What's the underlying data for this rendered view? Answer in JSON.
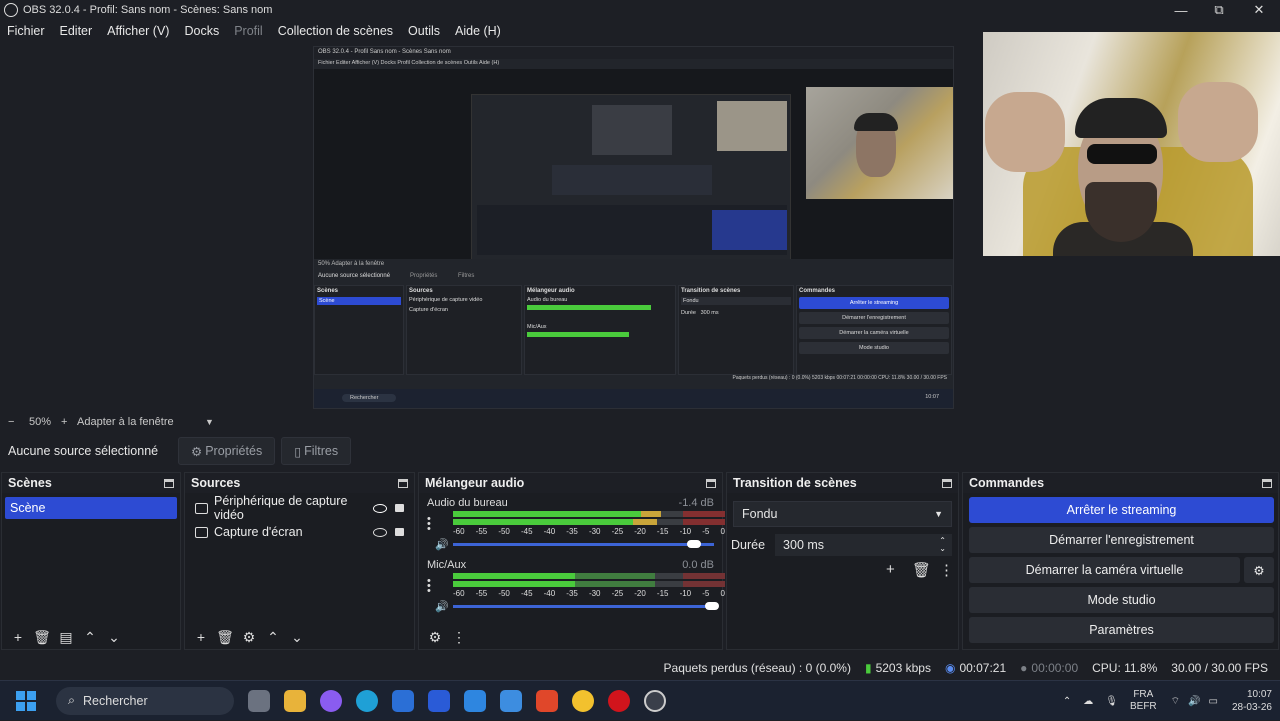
{
  "window": {
    "title": "OBS 32.0.4 - Profil: Sans nom - Scènes: Sans nom",
    "min": "—",
    "max": "⧉",
    "close": "✕"
  },
  "menu": {
    "items": [
      "Fichier",
      "Editer",
      "Afficher (V)",
      "Docks",
      "Profil",
      "Collection de scènes",
      "Outils",
      "Aide (H)"
    ]
  },
  "nested": {
    "title": "OBS 32.0.4 - Profil Sans nom - Scènes Sans nom",
    "menu": "Fichier   Editer   Afficher (V)   Docks   Profil   Collection de scènes   Outils   Aide (H)",
    "zoom": "50%   Adapter à la fenêtre",
    "no_source": "Aucune source sélectionné",
    "props": "Propriétés",
    "filters": "Filtres",
    "scenes_title": "Scènes",
    "scene": "Scène",
    "sources_title": "Sources",
    "src1": "Périphérique de capture vidéo",
    "src2": "Capture d'écran",
    "mixer_title": "Mélangeur audio",
    "ch1": "Audio du bureau",
    "ch2": "Mic/Aux",
    "trans_title": "Transition de scènes",
    "fade": "Fondu",
    "dur_label": "Durée",
    "dur": "300 ms",
    "cmd_title": "Commandes",
    "cmd": [
      "Arrêter le streaming",
      "Démarrer l'enregistrement",
      "Démarrer la caméra virtuelle",
      "Mode studio",
      "Paramètres"
    ],
    "status": "Paquets perdus (réseau) : 0 (0.0%)   5203 kbps   00:07:21   00:00:00   CPU: 11.8%   30.00 / 30.00 FPS",
    "search": "Rechercher",
    "clock": "10:07"
  },
  "zoom": {
    "minus": "−",
    "value": "50%",
    "plus": "+",
    "fit": "Adapter à la fenêtre"
  },
  "source_bar": {
    "no_source": "Aucune source sélectionné",
    "properties": "Propriétés",
    "filters": "Filtres"
  },
  "scenes": {
    "title": "Scènes",
    "items": [
      "Scène"
    ]
  },
  "sources": {
    "title": "Sources",
    "items": [
      "Périphérique de capture vidéo",
      "Capture d'écran"
    ]
  },
  "mixer": {
    "title": "Mélangeur audio",
    "channels": [
      {
        "name": "Audio du bureau",
        "db": "-1.4 dB",
        "level": 0.69,
        "volume": 0.92
      },
      {
        "name": "Mic/Aux",
        "db": "0.0 dB",
        "level": 0.45,
        "volume": 1.0
      }
    ],
    "scale": [
      "-60",
      "-55",
      "-50",
      "-45",
      "-40",
      "-35",
      "-30",
      "-25",
      "-20",
      "-15",
      "-10",
      "-5",
      "0"
    ]
  },
  "transition": {
    "title": "Transition de scènes",
    "type": "Fondu",
    "duration_label": "Durée",
    "duration": "300 ms"
  },
  "commands": {
    "title": "Commandes",
    "buttons": [
      "Arrêter le streaming",
      "Démarrer l'enregistrement",
      "Démarrer la caméra virtuelle",
      "Mode studio",
      "Paramètres"
    ]
  },
  "status": {
    "dropped": "Paquets perdus (réseau) : 0 (0.0%)",
    "kbps": "5203 kbps",
    "stream_time": "00:07:21",
    "rec_time": "00:00:00",
    "cpu": "CPU: 11.8%",
    "fps": "30.00 / 30.00 FPS"
  },
  "taskbar": {
    "search": "Rechercher",
    "lang1": "FRA",
    "lang2": "BEFR",
    "time": "10:07",
    "date": "28-03-26"
  },
  "colors": {
    "accent": "#2d4bd3",
    "meter_green": "#4acb3c",
    "meter_yellow": "#c9a53a",
    "meter_red": "#a22a2a"
  }
}
